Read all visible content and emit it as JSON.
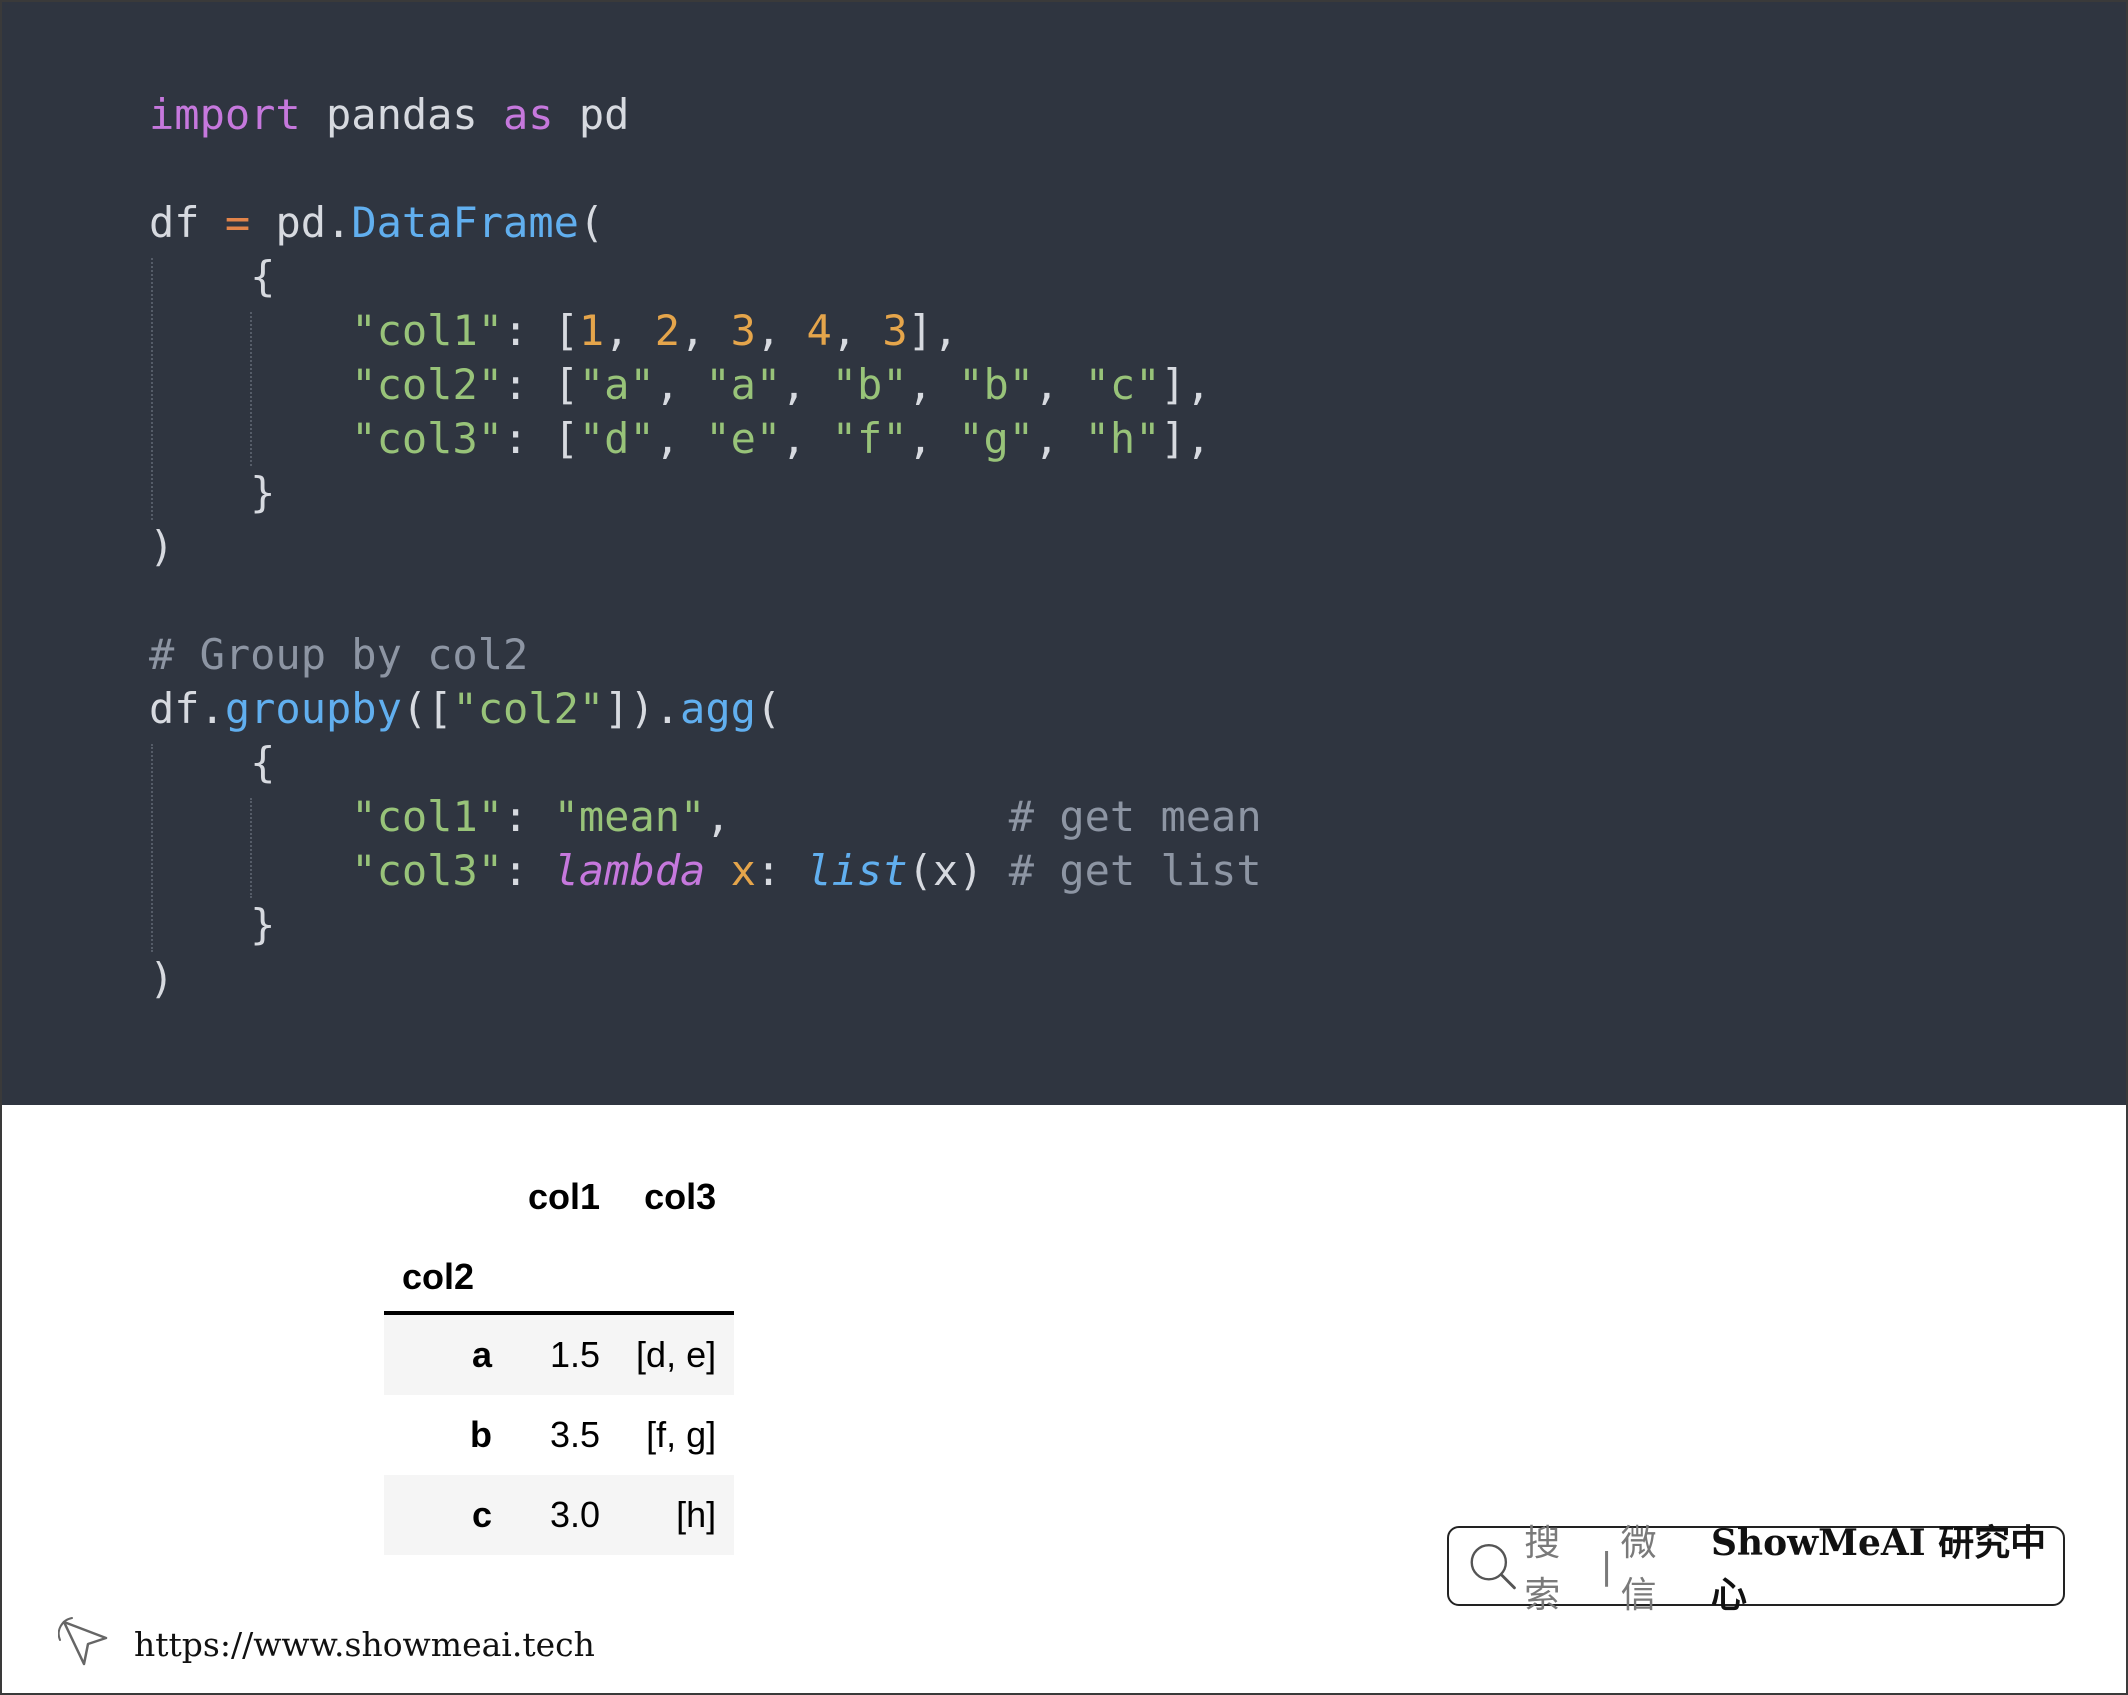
{
  "code": {
    "line1": {
      "kw_import": "import",
      "module": " pandas ",
      "kw_as": "as",
      "alias": " pd"
    },
    "line3": {
      "var": "df ",
      "eq": "=",
      "obj": " pd.",
      "cls": "DataFrame",
      "paren": "("
    },
    "line4": {
      "brace": "    {"
    },
    "line5": {
      "indent": "        ",
      "key": "\"col1\"",
      "colon": ": [",
      "n1": "1",
      "c1": ", ",
      "n2": "2",
      "c2": ", ",
      "n3": "3",
      "c3": ", ",
      "n4": "4",
      "c4": ", ",
      "n5": "3",
      "end": "],"
    },
    "line6": {
      "indent": "        ",
      "key": "\"col2\"",
      "colon": ": [",
      "s1": "\"a\"",
      "c1": ", ",
      "s2": "\"a\"",
      "c2": ", ",
      "s3": "\"b\"",
      "c3": ", ",
      "s4": "\"b\"",
      "c4": ", ",
      "s5": "\"c\"",
      "end": "],"
    },
    "line7": {
      "indent": "        ",
      "key": "\"col3\"",
      "colon": ": [",
      "s1": "\"d\"",
      "c1": ", ",
      "s2": "\"e\"",
      "c2": ", ",
      "s3": "\"f\"",
      "c3": ", ",
      "s4": "\"g\"",
      "c4": ", ",
      "s5": "\"h\"",
      "end": "],"
    },
    "line8": {
      "brace": "    }"
    },
    "line9": {
      "paren": ")"
    },
    "line11": {
      "comment": "# Group by col2"
    },
    "line12": {
      "var": "df.",
      "fn1": "groupby",
      "open": "([",
      "arg": "\"col2\"",
      "close": "]).",
      "fn2": "agg",
      "paren": "("
    },
    "line13": {
      "brace": "    {"
    },
    "line14": {
      "indent": "        ",
      "key": "\"col1\"",
      "colon": ": ",
      "val": "\"mean\"",
      "pad": ",           ",
      "comment": "# get mean"
    },
    "line15": {
      "indent": "        ",
      "key": "\"col3\"",
      "colon": ": ",
      "kw_lambda": "lambda",
      "sp": " ",
      "param": "x",
      "colon2": ": ",
      "fn": "list",
      "call": "(x) ",
      "comment": "# get list"
    },
    "line16": {
      "brace": "    }"
    },
    "line17": {
      "paren": ")"
    }
  },
  "output_table": {
    "columns": [
      "col1",
      "col3"
    ],
    "index_name": "col2",
    "rows": [
      {
        "index": "a",
        "col1": "1.5",
        "col3": "[d, e]"
      },
      {
        "index": "b",
        "col1": "3.5",
        "col3": "[f, g]"
      },
      {
        "index": "c",
        "col1": "3.0",
        "col3": "[h]"
      }
    ]
  },
  "badge": {
    "search": "搜索",
    "divider": "|",
    "wechat": "微信",
    "brand": "ShowMeAI 研究中心",
    "icon": "search-icon"
  },
  "footer": {
    "url": "https://www.showmeai.tech",
    "icon": "cursor-icon"
  },
  "colors": {
    "code_bg": "#2f3540",
    "keyword": "#c678dd",
    "function": "#61afef",
    "number": "#e5a54b",
    "string": "#98c379",
    "comment": "#8d95a3",
    "operator": "#e2844a"
  }
}
